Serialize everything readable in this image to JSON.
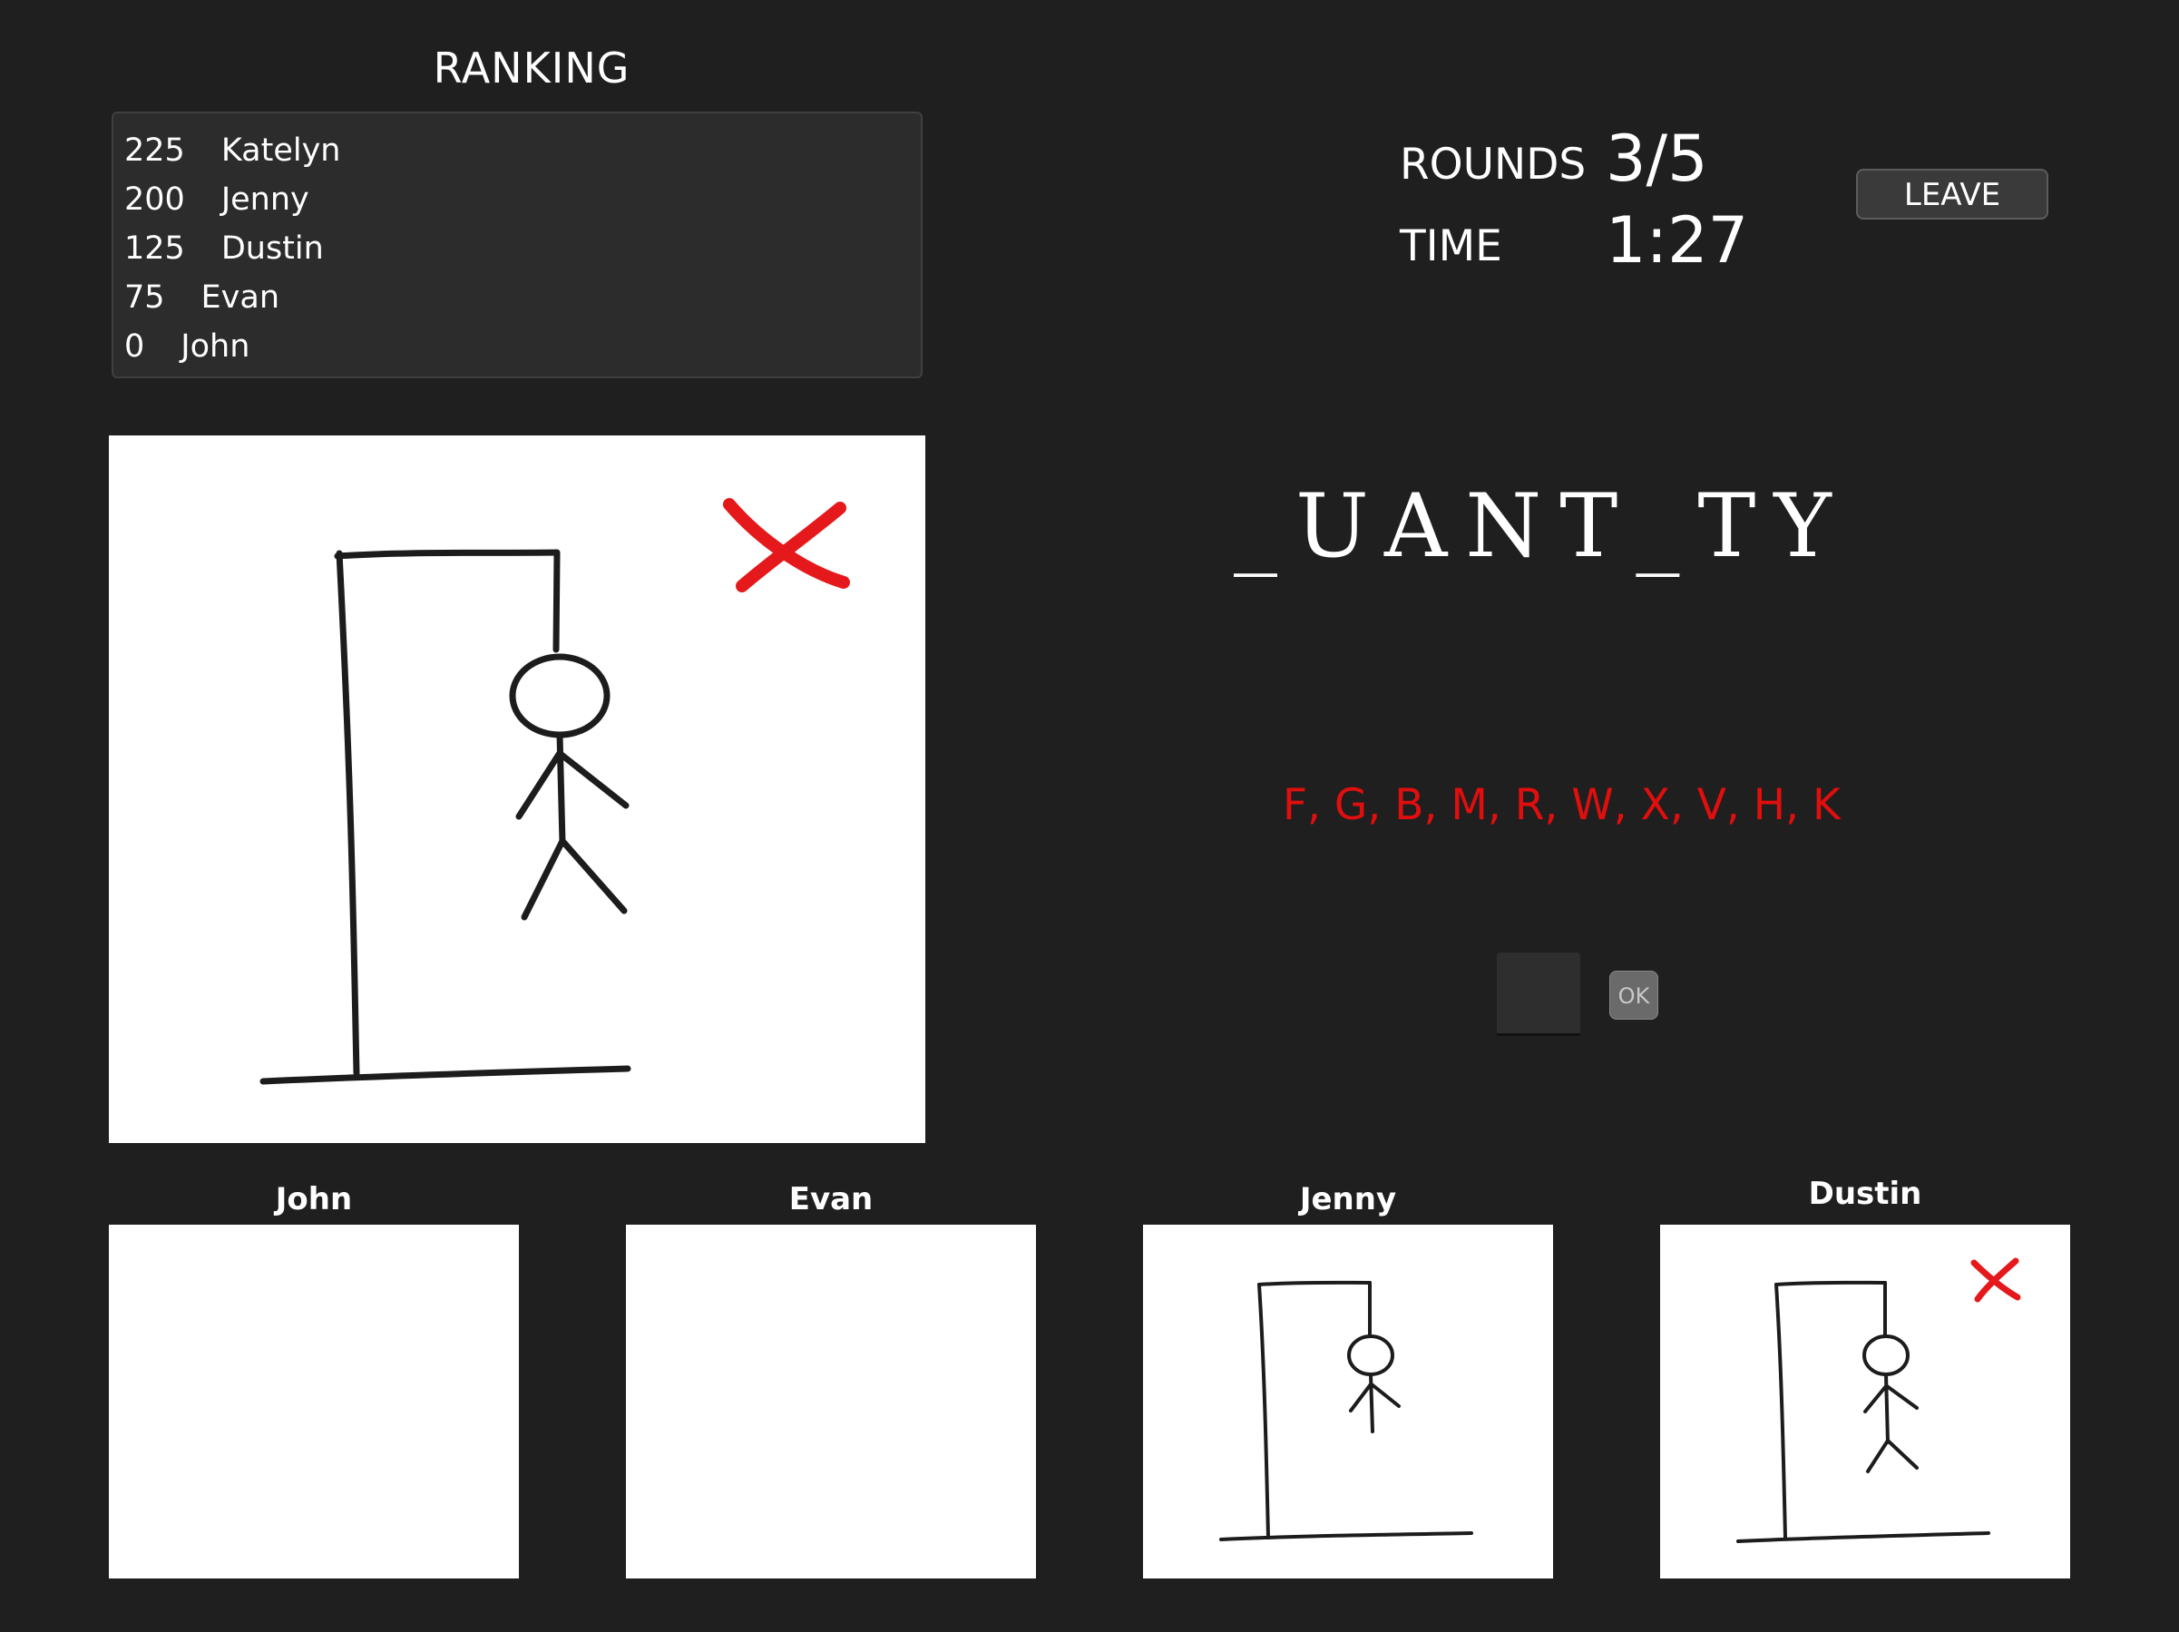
{
  "ranking": {
    "title": "RANKING",
    "entries": [
      {
        "score": "225",
        "name": "Katelyn"
      },
      {
        "score": "200",
        "name": "Jenny"
      },
      {
        "score": "125",
        "name": "Dustin"
      },
      {
        "score": "75",
        "name": "Evan"
      },
      {
        "score": "0",
        "name": "John"
      }
    ]
  },
  "stats": {
    "rounds_label": "ROUNDS",
    "rounds_value": "3/5",
    "time_label": "TIME",
    "time_value": "1:27"
  },
  "leave_label": "LEAVE",
  "main_board": {
    "wrong_mark": "cross-icon"
  },
  "word": "_UANT_TY",
  "wrong_letters": "F, G, B, M, R, W, X, V, H, K",
  "guess": {
    "value": "",
    "ok_label": "OK"
  },
  "players": [
    {
      "name": "John",
      "stage": "empty"
    },
    {
      "name": "Evan",
      "stage": "empty"
    },
    {
      "name": "Jenny",
      "stage": "hangman-partial"
    },
    {
      "name": "Dustin",
      "stage": "hangman-full",
      "wrong_mark": "cross-icon"
    }
  ],
  "colors": {
    "background": "#1f1f1f",
    "panel": "#2c2c2c",
    "wrong": "#e10e0e",
    "board": "#ffffff"
  }
}
